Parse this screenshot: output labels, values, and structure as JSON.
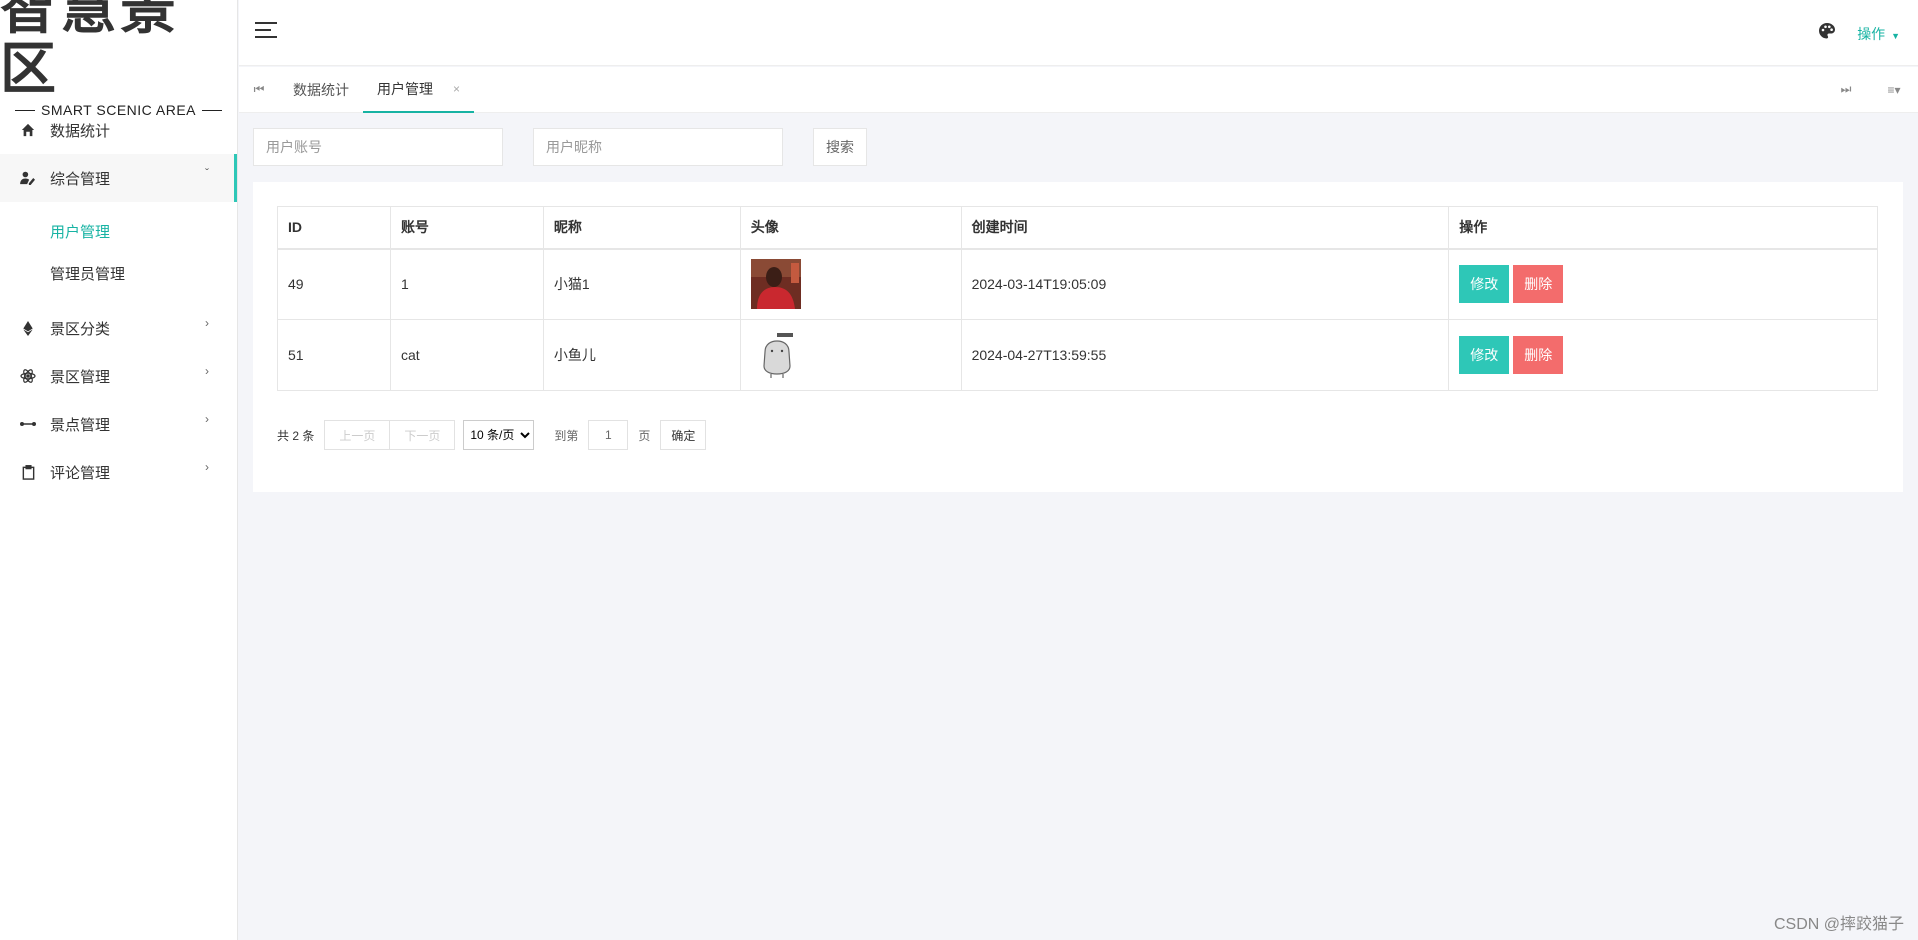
{
  "logo": {
    "title": "智慧景区",
    "subtitle": "SMART SCENIC AREA"
  },
  "sidebar": {
    "items": [
      {
        "label": "数据统计",
        "icon": "home-icon"
      },
      {
        "label": "综合管理",
        "icon": "user-edit-icon",
        "expanded": true,
        "children": [
          {
            "label": "用户管理",
            "active": true
          },
          {
            "label": "管理员管理"
          }
        ]
      },
      {
        "label": "景区分类",
        "icon": "ethereum-icon"
      },
      {
        "label": "景区管理",
        "icon": "atom-icon"
      },
      {
        "label": "景点管理",
        "icon": "arrows-h-icon"
      },
      {
        "label": "评论管理",
        "icon": "clipboard-icon"
      }
    ]
  },
  "header": {
    "operation_label": "操作"
  },
  "tabs": {
    "items": [
      {
        "label": "数据统计"
      },
      {
        "label": "用户管理",
        "active": true,
        "close": "×"
      }
    ]
  },
  "search": {
    "account_placeholder": "用户账号",
    "nickname_placeholder": "用户昵称",
    "button_label": "搜索"
  },
  "table": {
    "columns": [
      "ID",
      "账号",
      "昵称",
      "头像",
      "创建时间",
      "操作"
    ],
    "rows": [
      {
        "id": "49",
        "account": "1",
        "nickname": "小猫1",
        "avatar": "photo-avatar",
        "created": "2024-03-14T19:05:09"
      },
      {
        "id": "51",
        "account": "cat",
        "nickname": "小鱼儿",
        "avatar": "sketch-avatar",
        "created": "2024-04-27T13:59:55"
      }
    ],
    "edit_label": "修改",
    "delete_label": "删除"
  },
  "pagination": {
    "total_text": "共 2 条",
    "prev_label": "上一页",
    "next_label": "下一页",
    "page_size_label": "10 条/页",
    "goto_label": "到第",
    "page_value": "1",
    "page_unit": "页",
    "confirm_label": "确定"
  },
  "colors": {
    "accent": "#17b3a3",
    "edit_button": "#2ec7b7",
    "delete_button": "#f36c6c"
  },
  "watermark": "CSDN @摔跤猫子"
}
